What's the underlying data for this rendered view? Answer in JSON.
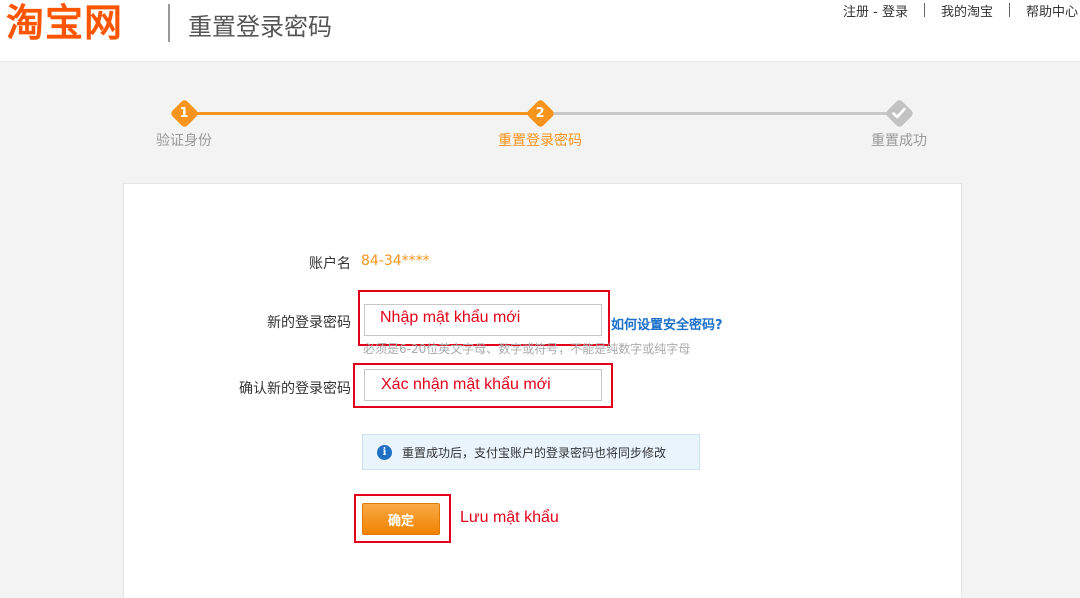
{
  "header": {
    "logo": "淘宝网",
    "title": "重置登录密码",
    "links": {
      "register_login": "注册 - 登录",
      "my_taobao": "我的淘宝",
      "help_center": "帮助中心"
    }
  },
  "steps": [
    {
      "number": "1",
      "label": "验证身份"
    },
    {
      "number": "2",
      "label": "重置登录密码"
    },
    {
      "number": "",
      "label": "重置成功"
    }
  ],
  "form": {
    "account_label": "账户名",
    "account_value": "84-34****",
    "new_password_label": "新的登录密码",
    "new_password_value": "Nhập mật khẩu mới",
    "help_link": "如何设置安全密码?",
    "hint": "必须是6-20位英文字母、数字或符号，不能是纯数字或纯字母",
    "confirm_password_label": "确认新的登录密码",
    "confirm_password_value": "Xác nhận mật khẩu mới",
    "notice_icon": "i",
    "notice": "重置成功后，支付宝账户的登录密码也将同步修改",
    "submit_label": "确定",
    "save_annotation": "Lưu mật khẩu"
  },
  "colors": {
    "brand": "#ff5500",
    "step_active": "#f7941d",
    "step_inactive": "#c2c2c2",
    "annotation_red": "#e3001b",
    "link_blue": "#1a6fc9"
  }
}
